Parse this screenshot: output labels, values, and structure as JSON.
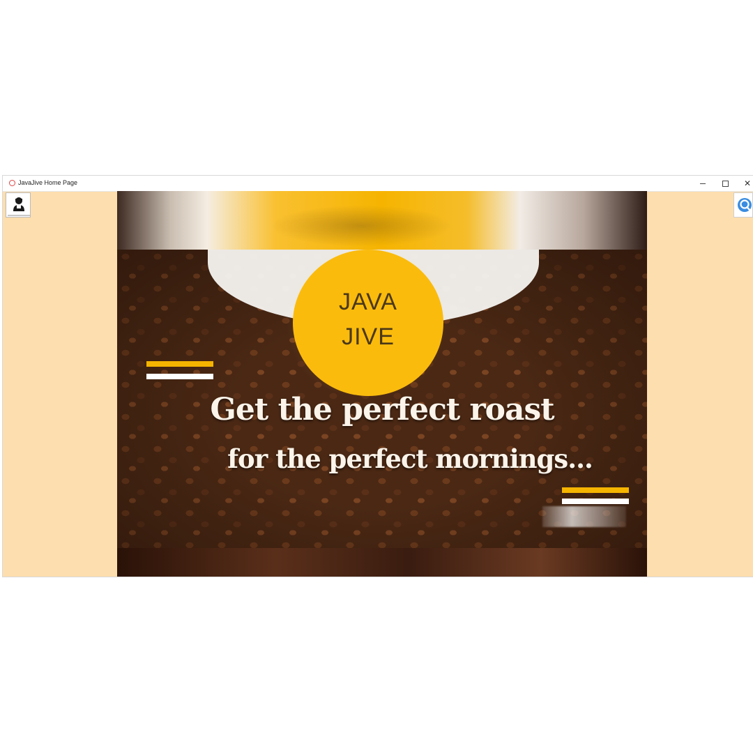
{
  "window": {
    "title": "JavaJive Home Page",
    "controls": {
      "minimize": "minimize",
      "maximize": "maximize",
      "close": "✕"
    }
  },
  "toolbar": {
    "profile_icon": "user-icon",
    "search_icon": "search-icon"
  },
  "hero": {
    "logo_line1": "JAVA",
    "logo_line2": "JIVE",
    "tagline_line1": "Get the perfect roast",
    "tagline_line2": "for the perfect mornings..."
  },
  "colors": {
    "page_background": "#fddeae",
    "brand_yellow": "#fbbb0c",
    "accent_yellow": "#f5b400",
    "logo_text": "#4a3818",
    "search_blue": "#3a8de0"
  }
}
